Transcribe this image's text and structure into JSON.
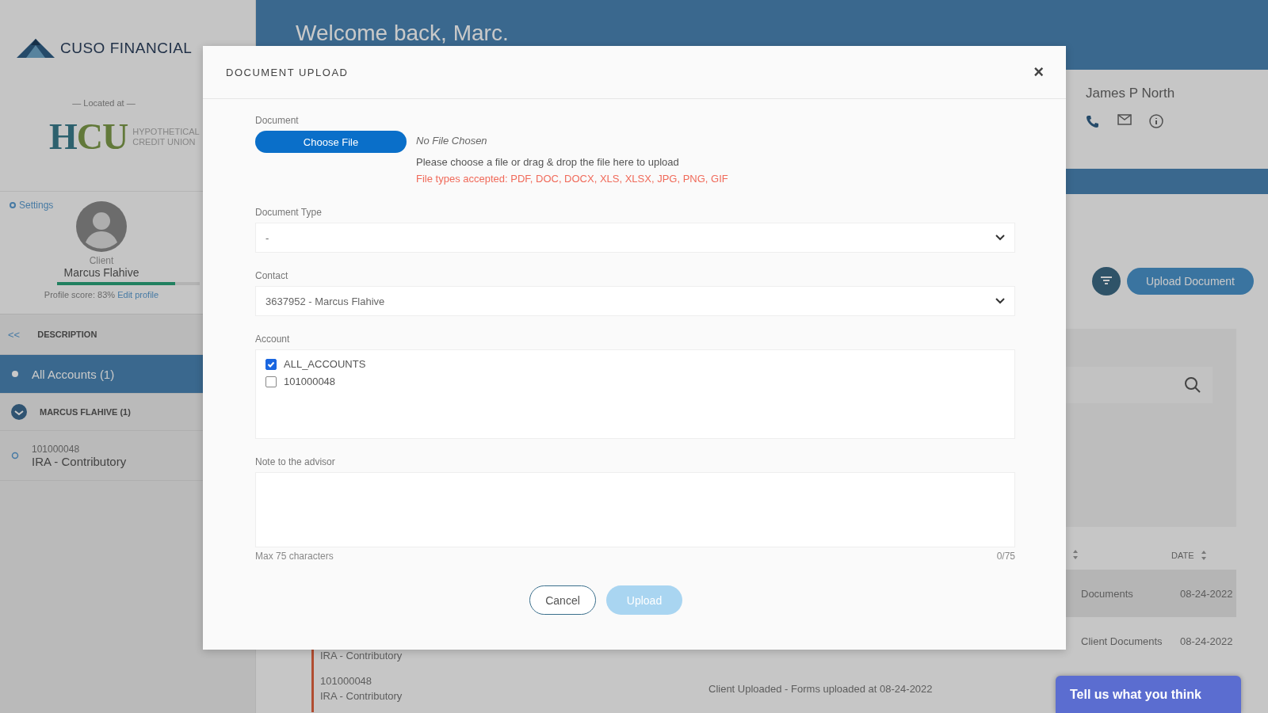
{
  "sidebar": {
    "brand": "CUSO FINANCIAL",
    "located_label": "— Located at —",
    "credit_union": {
      "initials": "HCU",
      "name_lines": [
        "HYPOTHETICAL",
        "CREDIT UNION"
      ]
    },
    "settings_link": "Settings",
    "profile": {
      "role": "Client",
      "name": "Marcus Flahive",
      "level": 0.83,
      "score_label": "Profile score: 83%",
      "edit_link": "Edit profile"
    },
    "accounts_table": {
      "collapse": "<<",
      "column": "DESCRIPTION",
      "rows": [
        {
          "kind": "all",
          "label": "All Accounts (1)",
          "selected": true
        },
        {
          "kind": "owner",
          "label": "MARCUS FLAHIVE (1)",
          "selected": false
        },
        {
          "kind": "account",
          "number": "101000048",
          "label": "IRA - Contributory",
          "selected": false
        }
      ]
    }
  },
  "main": {
    "welcome": "Welcome back, Marc.",
    "advisor": {
      "name": "James P North"
    },
    "upload_button": "Upload Document",
    "documents_table": {
      "date_column": "DATE",
      "rows": [
        {
          "category": "Documents",
          "date": "08-24-2022",
          "highlighted": true
        },
        {
          "account_type": "IRA - Contributory",
          "category": "Client Documents",
          "date": "08-24-2022",
          "highlighted": false
        },
        {
          "account": "101000048",
          "account_type": "IRA - Contributory",
          "activity": "Client Uploaded - Forms uploaded at 08-24-2022",
          "highlighted": false
        }
      ]
    }
  },
  "modal": {
    "title": "DOCUMENT UPLOAD",
    "close": "×",
    "document_label": "Document",
    "choose_button": "Choose File",
    "file_status": "No File Chosen",
    "hint": "Please choose a file or drag & drop the file here to upload",
    "accepted_types": "File types accepted: PDF, DOC, DOCX, XLS, XLSX, JPG, PNG, GIF",
    "document_type": {
      "label": "Document Type",
      "value": "-"
    },
    "contact": {
      "label": "Contact",
      "value": "3637952 - Marcus Flahive"
    },
    "account": {
      "label": "Account",
      "options": [
        {
          "label": "ALL_ACCOUNTS",
          "checked": true
        },
        {
          "label": "101000048",
          "checked": false
        }
      ]
    },
    "note": {
      "label": "Note to the advisor",
      "limit_hint": "Max 75 characters",
      "counter": "0/75"
    },
    "cancel_button": "Cancel",
    "upload_button": {
      "label": "Upload",
      "disabled": true
    }
  },
  "feedback_button": "Tell us what you think"
}
